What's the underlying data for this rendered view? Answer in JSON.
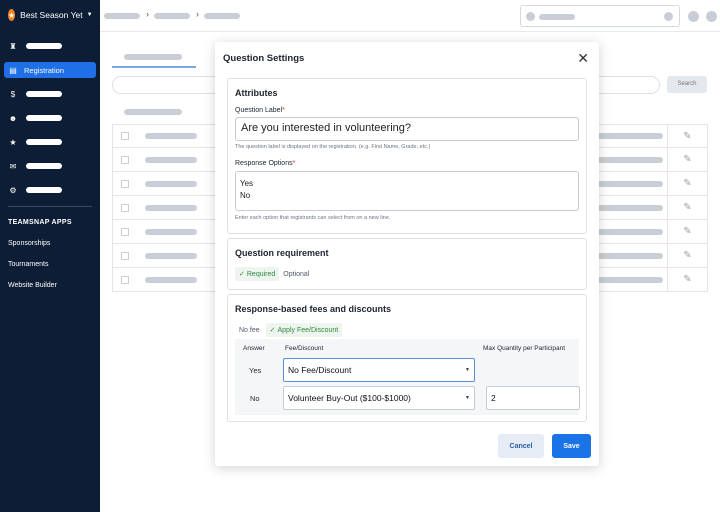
{
  "sidebar": {
    "org_name": "Best Season Yet",
    "active_item": "Registration",
    "apps_heading": "TEAMSNAP APPS",
    "app_links": [
      "Sponsorships",
      "Tournaments",
      "Website Builder"
    ]
  },
  "background": {
    "search_button": "Search"
  },
  "modal": {
    "title": "Question Settings",
    "attributes": {
      "title": "Attributes",
      "question_label": "Question Label",
      "question_value": "Are you interested in volunteering?",
      "question_help": "The question label is displayed on the registration. (e.g. First Name, Grade, etc.)",
      "options_label": "Response Options",
      "options": [
        "Yes",
        "No"
      ],
      "options_help": "Enter each option that registrants can select from on a new line."
    },
    "requirement": {
      "title": "Question requirement",
      "required": "Required",
      "optional": "Optional"
    },
    "fees": {
      "title": "Response-based fees and discounts",
      "no_fee": "No fee",
      "apply": "Apply Fee/Discount",
      "col_answer": "Answer",
      "col_fee": "Fee/Discount",
      "col_max": "Max Quantity per Participant",
      "rows": [
        {
          "answer": "Yes",
          "fee": "No Fee/Discount",
          "max": ""
        },
        {
          "answer": "No",
          "fee": "Volunteer Buy-Out ($100-$1000)",
          "max": "2"
        }
      ]
    },
    "cancel": "Cancel",
    "save": "Save"
  }
}
